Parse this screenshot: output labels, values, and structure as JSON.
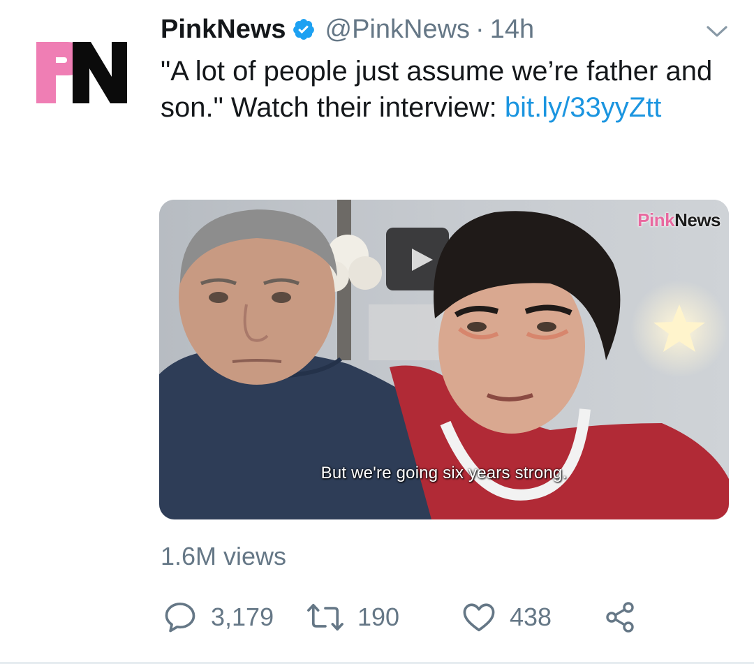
{
  "tweet": {
    "display_name": "PinkNews",
    "handle": "@PinkNews",
    "separator": "·",
    "time": "14h",
    "avatar_logo_text": "PN",
    "verified_icon": "verified-badge-icon",
    "menu_icon": "chevron-down-icon",
    "text_main": "\"A lot of people just assume we’re father and son.\" Watch their interview: ",
    "text_link": "bit.ly/33yyZtt",
    "media": {
      "watermark_pink": "Pink",
      "watermark_dark": "News",
      "subtitle": "But we're going six years strong."
    },
    "views": "1.6M views",
    "actions": {
      "reply_count": "3,179",
      "retweet_count": "190",
      "like_count": "438",
      "icons": [
        "reply-icon",
        "retweet-icon",
        "like-icon",
        "share-icon"
      ]
    }
  },
  "colors": {
    "link": "#1b95e0",
    "muted": "#657786",
    "text": "#14171a",
    "verified": "#1da1f2",
    "brand_pink": "#e8699f"
  }
}
